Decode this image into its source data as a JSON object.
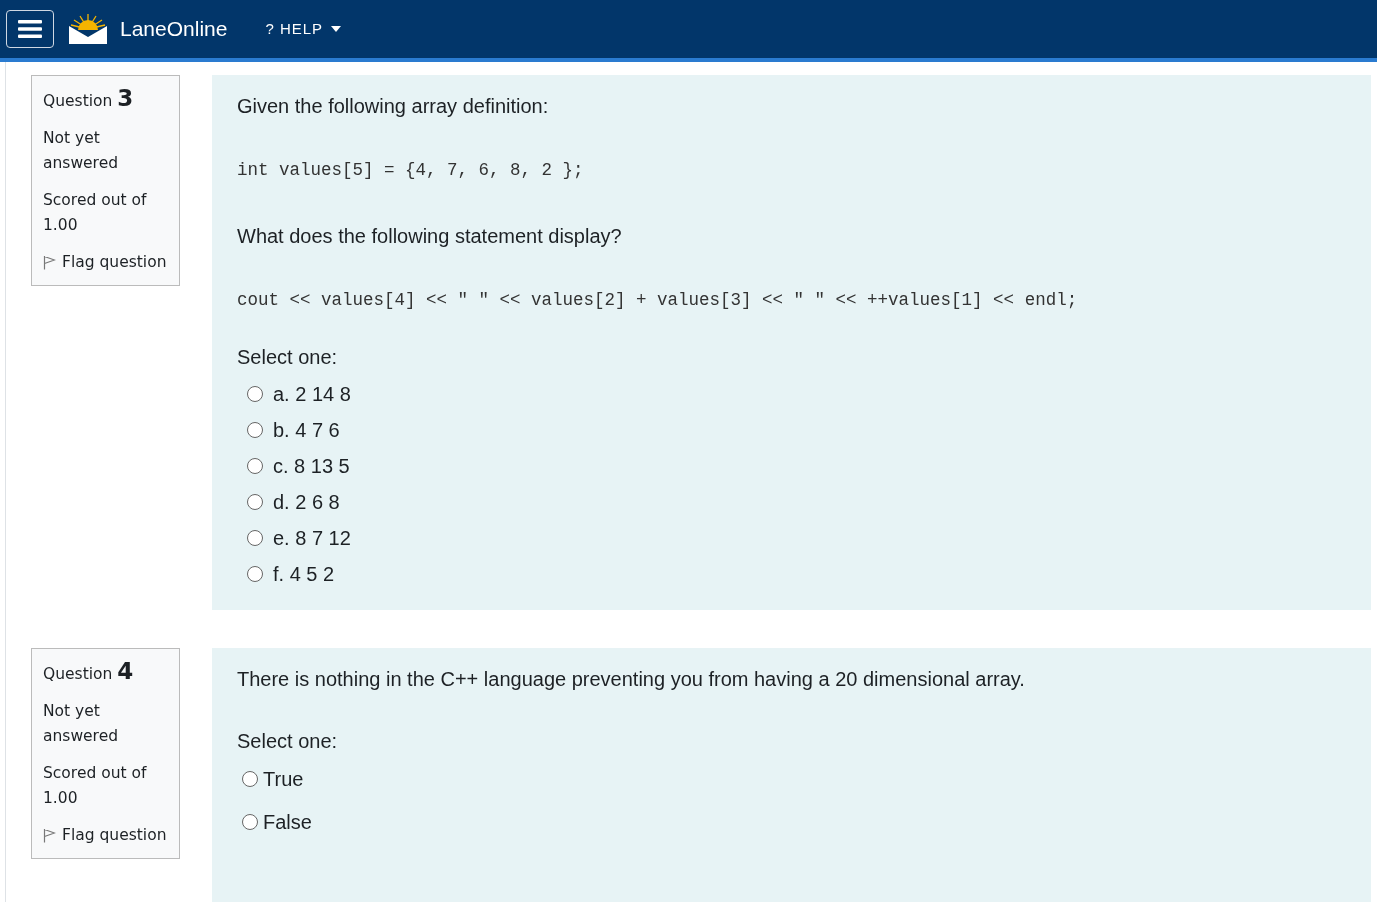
{
  "navbar": {
    "brand": "LaneOnline",
    "help_menu": "? HELP"
  },
  "questions": [
    {
      "label": "Question",
      "number": "3",
      "status": "Not yet answered",
      "mark": "Scored out of 1.00",
      "flag": "Flag question",
      "flagged": false,
      "blocks": [
        {
          "kind": "text",
          "text": "Given the following array definition:"
        },
        {
          "kind": "code",
          "text": "int values[5] = {4, 7, 6, 8, 2 };"
        },
        {
          "kind": "text",
          "text": "What does the following statement display?"
        },
        {
          "kind": "code",
          "text": "cout << values[4] << \" \" << values[2] + values[3] << \" \" << ++values[1] << endl;"
        }
      ],
      "prompt": "Select one:",
      "options": [
        {
          "label": "a. 2 14 8",
          "selected": false
        },
        {
          "label": "b. 4 7 6",
          "selected": false
        },
        {
          "label": "c. 8 13 5",
          "selected": false
        },
        {
          "label": "d. 2 6 8",
          "selected": false
        },
        {
          "label": "e. 8 7 12",
          "selected": false
        },
        {
          "label": "f. 4 5 2",
          "selected": false
        }
      ]
    },
    {
      "label": "Question",
      "number": "4",
      "status": "Not yet answered",
      "mark": "Scored out of 1.00",
      "flag": "Flag question",
      "flagged": false,
      "blocks": [
        {
          "kind": "text",
          "text": "There is nothing in the C++ language preventing you from having a 20 dimensional array."
        }
      ],
      "prompt": "Select one:",
      "options": [
        {
          "label": "True",
          "selected": false
        },
        {
          "label": "False",
          "selected": false
        }
      ]
    }
  ]
}
